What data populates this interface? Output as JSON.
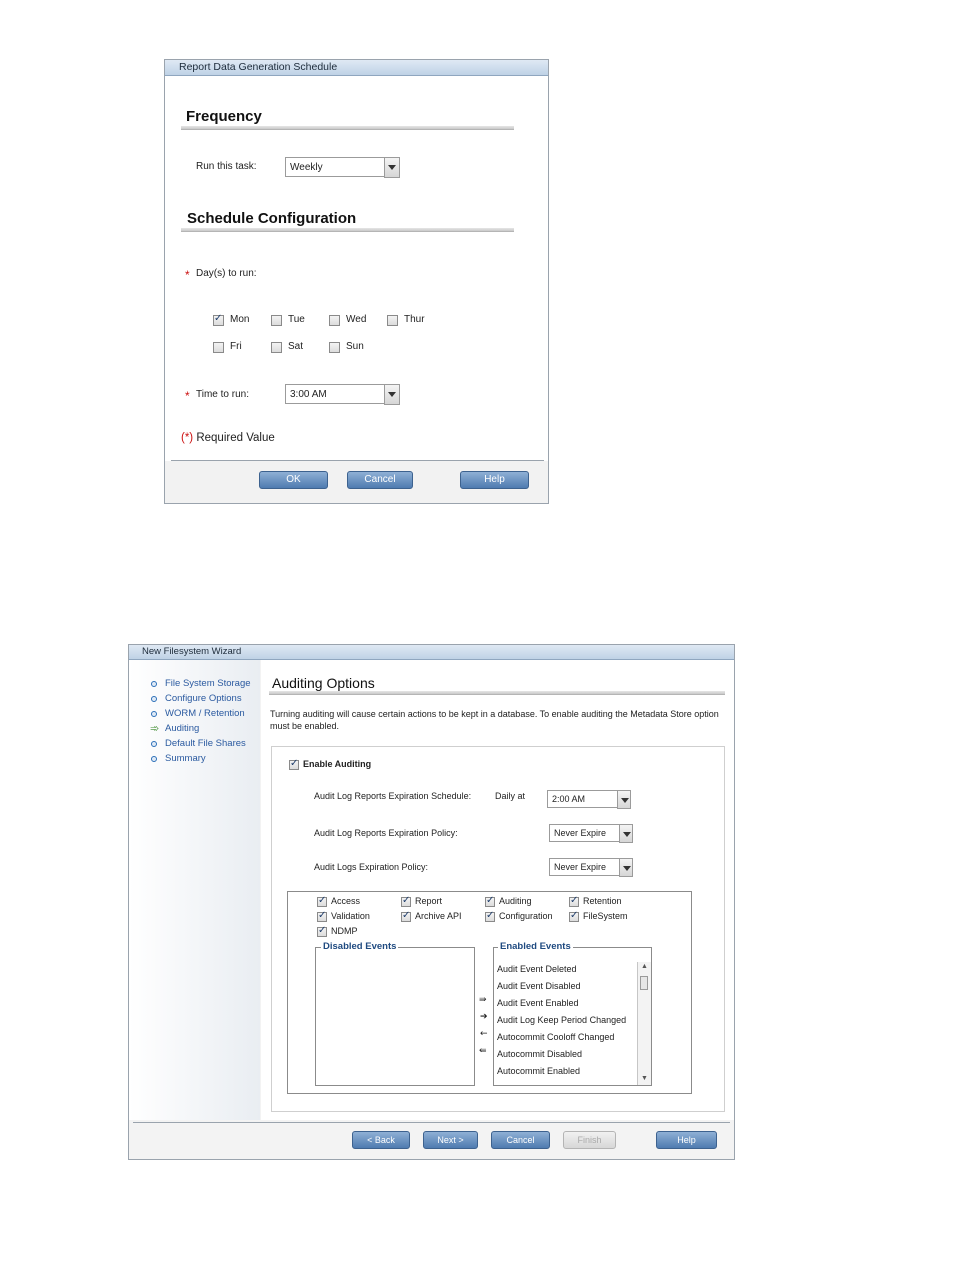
{
  "schedule_dialog": {
    "title": "Report Data Generation Schedule",
    "frequency_heading": "Frequency",
    "run_task_label": "Run this task:",
    "run_task_value": "Weekly",
    "schedule_heading": "Schedule Configuration",
    "days_label": "Day(s) to run:",
    "days": [
      {
        "label": "Mon",
        "checked": true
      },
      {
        "label": "Tue",
        "checked": false
      },
      {
        "label": "Wed",
        "checked": false
      },
      {
        "label": "Thur",
        "checked": false
      },
      {
        "label": "Fri",
        "checked": false
      },
      {
        "label": "Sat",
        "checked": false
      },
      {
        "label": "Sun",
        "checked": false
      }
    ],
    "time_label": "Time to run:",
    "time_value": "3:00 AM",
    "required_marker": "(*)",
    "required_text": " Required Value",
    "asterisk": "*",
    "buttons": {
      "ok": "OK",
      "cancel": "Cancel",
      "help": "Help"
    }
  },
  "wizard": {
    "title": "New Filesystem Wizard",
    "nav": [
      {
        "label": "File System Storage",
        "current": false
      },
      {
        "label": "Configure Options",
        "current": false
      },
      {
        "label": "WORM / Retention",
        "current": false
      },
      {
        "label": "Auditing",
        "current": true
      },
      {
        "label": "Default File Shares",
        "current": false
      },
      {
        "label": "Summary",
        "current": false
      }
    ],
    "heading": "Auditing Options",
    "description": "Turning auditing will cause certain actions to be kept in a database. To enable auditing the Metadata Store option must be enabled.",
    "enable_label": "Enable Auditing",
    "schedule_label": "Audit Log Reports Expiration Schedule:",
    "schedule_prefix": "Daily at",
    "schedule_value": "2:00 AM",
    "reports_policy_label": "Audit Log Reports Expiration Policy:",
    "reports_policy_value": "Never Expire",
    "logs_policy_label": "Audit Logs Expiration Policy:",
    "logs_policy_value": "Never Expire",
    "categories": [
      "Access",
      "Report",
      "Auditing",
      "Retention",
      "Validation",
      "Archive API",
      "Configuration",
      "FileSystem",
      "NDMP"
    ],
    "disabled_events_title": "Disabled Events",
    "enabled_events_title": "Enabled Events",
    "enabled_events": [
      "Audit Event Deleted",
      "Audit Event Disabled",
      "Audit Event Enabled",
      "Audit Log Keep Period Changed",
      "Autocommit Cooloff Changed",
      "Autocommit Disabled",
      "Autocommit Enabled"
    ],
    "move_icons": [
      "move-all-right-icon",
      "move-right-icon",
      "move-left-icon",
      "move-all-left-icon"
    ],
    "buttons": {
      "back": "< Back",
      "next": "Next >",
      "cancel": "Cancel",
      "finish": "Finish",
      "help": "Help"
    }
  }
}
